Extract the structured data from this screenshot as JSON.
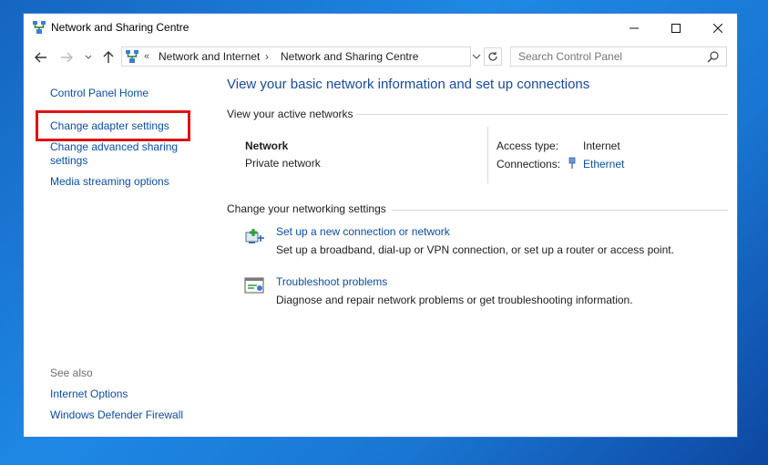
{
  "window": {
    "title": "Network and Sharing Centre"
  },
  "address": {
    "crumbs": [
      "Network and Internet",
      "Network and Sharing Centre"
    ],
    "overflow": "«"
  },
  "search": {
    "placeholder": "Search Control Panel"
  },
  "sidebar": {
    "items": [
      "Control Panel Home",
      "Change adapter settings",
      "Change advanced sharing settings",
      "Media streaming options"
    ],
    "see_also_label": "See also",
    "see_also": [
      "Internet Options",
      "Windows Defender Firewall"
    ]
  },
  "main": {
    "title": "View your basic network information and set up connections",
    "active_networks_label": "View your active networks",
    "network": {
      "name": "Network",
      "category": "Private network"
    },
    "access_type_label": "Access type:",
    "access_type_value": "Internet",
    "connections_label": "Connections:",
    "connections_value": "Ethernet",
    "change_settings_label": "Change your networking settings",
    "tasks": [
      {
        "title": "Set up a new connection or network",
        "desc": "Set up a broadband, dial-up or VPN connection, or set up a router or access point."
      },
      {
        "title": "Troubleshoot problems",
        "desc": "Diagnose and repair network problems or get troubleshooting information."
      }
    ]
  },
  "colors": {
    "link": "#0b4ea2",
    "highlight": "#e01313",
    "title": "#1a4a9b"
  }
}
